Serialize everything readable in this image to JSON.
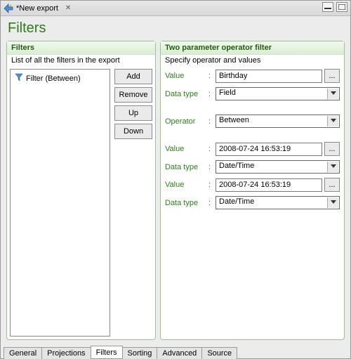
{
  "titlebar": {
    "title": "*New export"
  },
  "page_title": "Filters",
  "left": {
    "title": "Filters",
    "subtitle": "List of all the filters in the export",
    "tree_item": "Filter (Between)"
  },
  "buttons": {
    "add": "Add",
    "remove": "Remove",
    "up": "Up",
    "down": "Down"
  },
  "right": {
    "title": "Two parameter operator filter",
    "subtitle": "Specify operator and values",
    "labels": {
      "value": "Value",
      "datatype": "Data type",
      "operator": "Operator"
    },
    "values": {
      "value1": "Birthday",
      "datatype1": "Field",
      "operator": "Between",
      "value2": "2008-07-24 16:53:19",
      "datatype2": "Date/Time",
      "value3": "2008-07-24 16:53:19",
      "datatype3": "Date/Time"
    },
    "ellipsis": "..."
  },
  "tabs": {
    "general": "General",
    "projections": "Projections",
    "filters": "Filters",
    "sorting": "Sorting",
    "advanced": "Advanced",
    "source": "Source"
  }
}
